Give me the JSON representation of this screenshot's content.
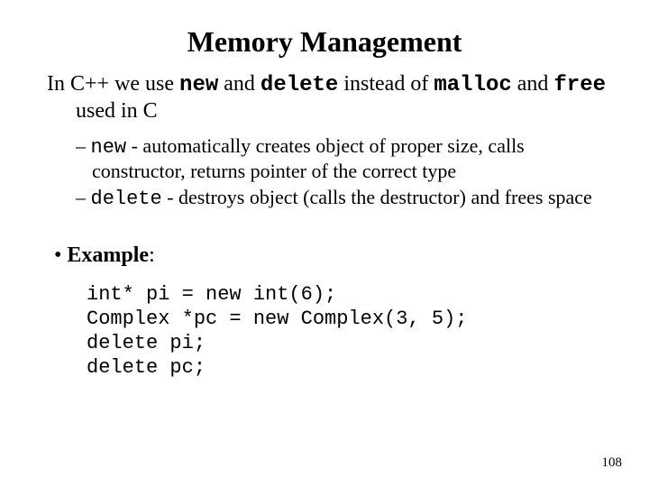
{
  "title": "Memory Management",
  "intro": {
    "p1": "In C++ we use ",
    "kw1": "new",
    "p2": " and ",
    "kw2": "delete",
    "p3": " instead of ",
    "kw3": "malloc",
    "p4": " and  ",
    "kw4": "free",
    "p5": "  used in C"
  },
  "sub": {
    "dash": "– ",
    "i1": {
      "kw": "new",
      "rest": " - automatically creates object of proper size, calls constructor, returns pointer of the correct type"
    },
    "i2": {
      "kw": "delete",
      "rest": " - destroys object (calls the destructor) and frees space"
    }
  },
  "example": {
    "bullet": "•  ",
    "label": "Example",
    "colon": ":"
  },
  "code": "int* pi = new int(6);\nComplex *pc = new Complex(3, 5);\ndelete pi;\ndelete pc;",
  "pagenum": "108"
}
